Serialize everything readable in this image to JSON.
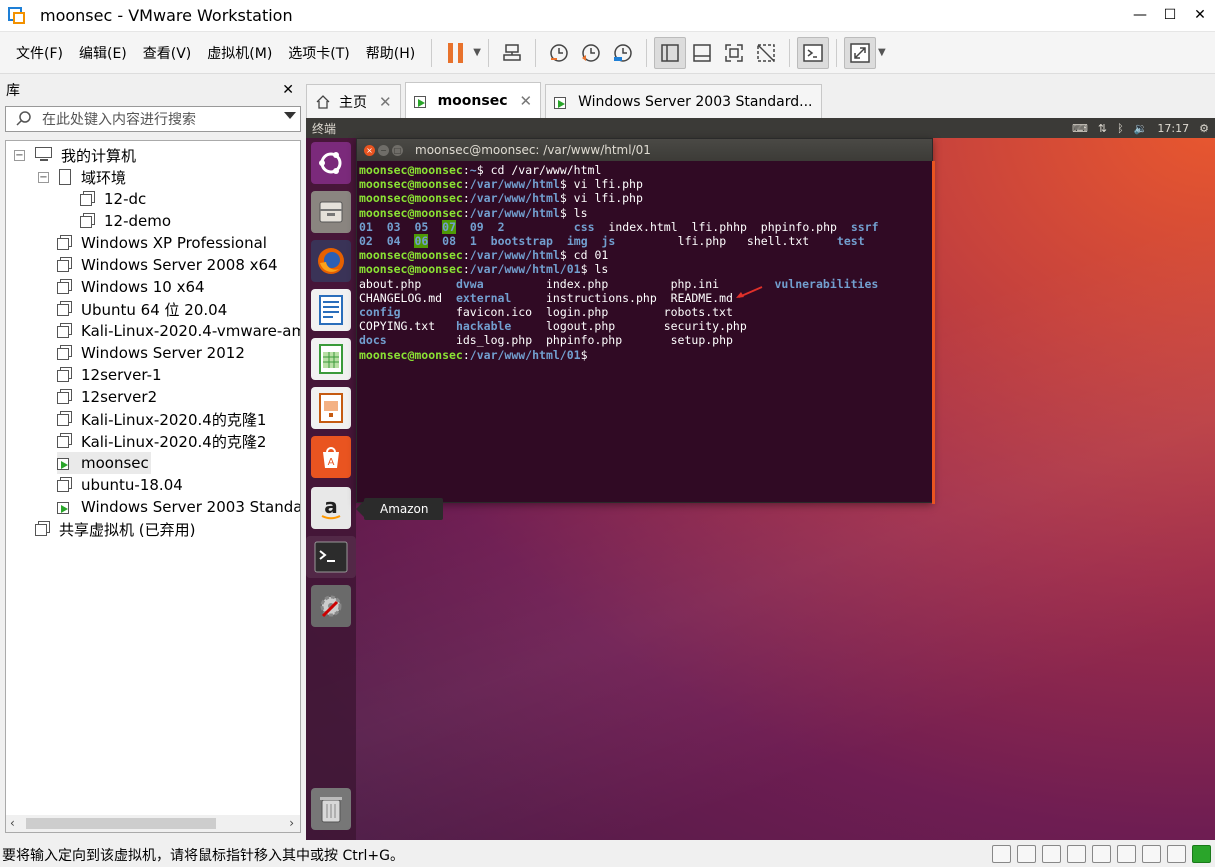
{
  "window": {
    "title": "moonsec - VMware Workstation",
    "controls": [
      "—",
      "☐",
      "✕"
    ]
  },
  "menu": [
    "文件(F)",
    "编辑(E)",
    "查看(V)",
    "虚拟机(M)",
    "选项卡(T)",
    "帮助(H)"
  ],
  "library": {
    "title": "库",
    "close": "✕",
    "search_placeholder": "在此处键入内容进行搜索",
    "tree": {
      "root": "我的计算机",
      "folder": "域环境",
      "folder_items": [
        "12-dc",
        "12-demo"
      ],
      "items": [
        {
          "label": "Windows XP Professional",
          "icon": "vm-icon"
        },
        {
          "label": "Windows Server 2008 x64",
          "icon": "vm-icon"
        },
        {
          "label": "Windows 10 x64",
          "icon": "vm-icon"
        },
        {
          "label": "Ubuntu 64 位 20.04",
          "icon": "vm-icon"
        },
        {
          "label": "Kali-Linux-2020.4-vmware-amd64",
          "icon": "vm-icon"
        },
        {
          "label": "Windows Server 2012",
          "icon": "vm-icon"
        },
        {
          "label": "12server-1",
          "icon": "vm-icon"
        },
        {
          "label": "12server2",
          "icon": "vm-icon"
        },
        {
          "label": "Kali-Linux-2020.4的克隆1",
          "icon": "clone-icon"
        },
        {
          "label": "Kali-Linux-2020.4的克隆2",
          "icon": "clone-icon"
        },
        {
          "label": "moonsec",
          "icon": "running-vm-icon"
        },
        {
          "label": "ubuntu-18.04",
          "icon": "vm-icon"
        },
        {
          "label": "Windows Server 2003 Standard",
          "icon": "running-vm-icon"
        }
      ],
      "shared": "共享虚拟机 (已弃用)"
    }
  },
  "tabs": [
    {
      "label": "主页",
      "icon": "home-icon"
    },
    {
      "label": "moonsec",
      "icon": "running-vm-icon"
    },
    {
      "label": "Windows Server 2003 Standard...",
      "icon": "running-vm-icon"
    }
  ],
  "ubuntu": {
    "topbar_title": "终端",
    "clock": "17:17",
    "tooltip": "Amazon",
    "terminal_title": "moonsec@moonsec: /var/www/html/01"
  },
  "terminal": {
    "prompt_user": "moonsec@moonsec",
    "lines": [
      {
        "path": "~",
        "cmd": "cd /var/www/html"
      },
      {
        "path": "/var/www/html",
        "cmd": "vi lfi.php"
      },
      {
        "path": "/var/www/html",
        "cmd": "vi lfi.php"
      },
      {
        "path": "/var/www/html",
        "cmd": "ls"
      }
    ],
    "ls1_row1": [
      "01",
      "03",
      "05",
      "07",
      "09",
      "2",
      "css",
      "index.html",
      "lfi.phhp",
      "phpinfo.php",
      "ssrf"
    ],
    "ls1_row2": [
      "02",
      "04",
      "06",
      "08",
      "1",
      "bootstrap",
      "img",
      "js",
      "lfi.php",
      "shell.txt",
      "test"
    ],
    "line5": {
      "path": "/var/www/html",
      "cmd": "cd 01"
    },
    "line6": {
      "path": "/var/www/html/01",
      "cmd": "ls"
    },
    "ls2": [
      [
        "about.php",
        "dvwa",
        "index.php",
        "php.ini",
        "vulnerabilities"
      ],
      [
        "CHANGELOG.md",
        "external",
        "instructions.php",
        "README.md",
        ""
      ],
      [
        "config",
        "favicon.ico",
        "login.php",
        "robots.txt",
        ""
      ],
      [
        "COPYING.txt",
        "hackable",
        "logout.php",
        "security.php",
        ""
      ],
      [
        "docs",
        "ids_log.php",
        "phpinfo.php",
        "setup.php",
        ""
      ]
    ],
    "last": {
      "path": "/var/www/html/01"
    }
  },
  "status": {
    "message": "要将输入定向到该虚拟机，请将鼠标指针移入其中或按 Ctrl+G。"
  },
  "colors": {
    "prompt_green": "#8ae234",
    "path_blue": "#729fcf",
    "terminal_bg": "#300a24",
    "ubuntu_orange": "#e95420"
  }
}
